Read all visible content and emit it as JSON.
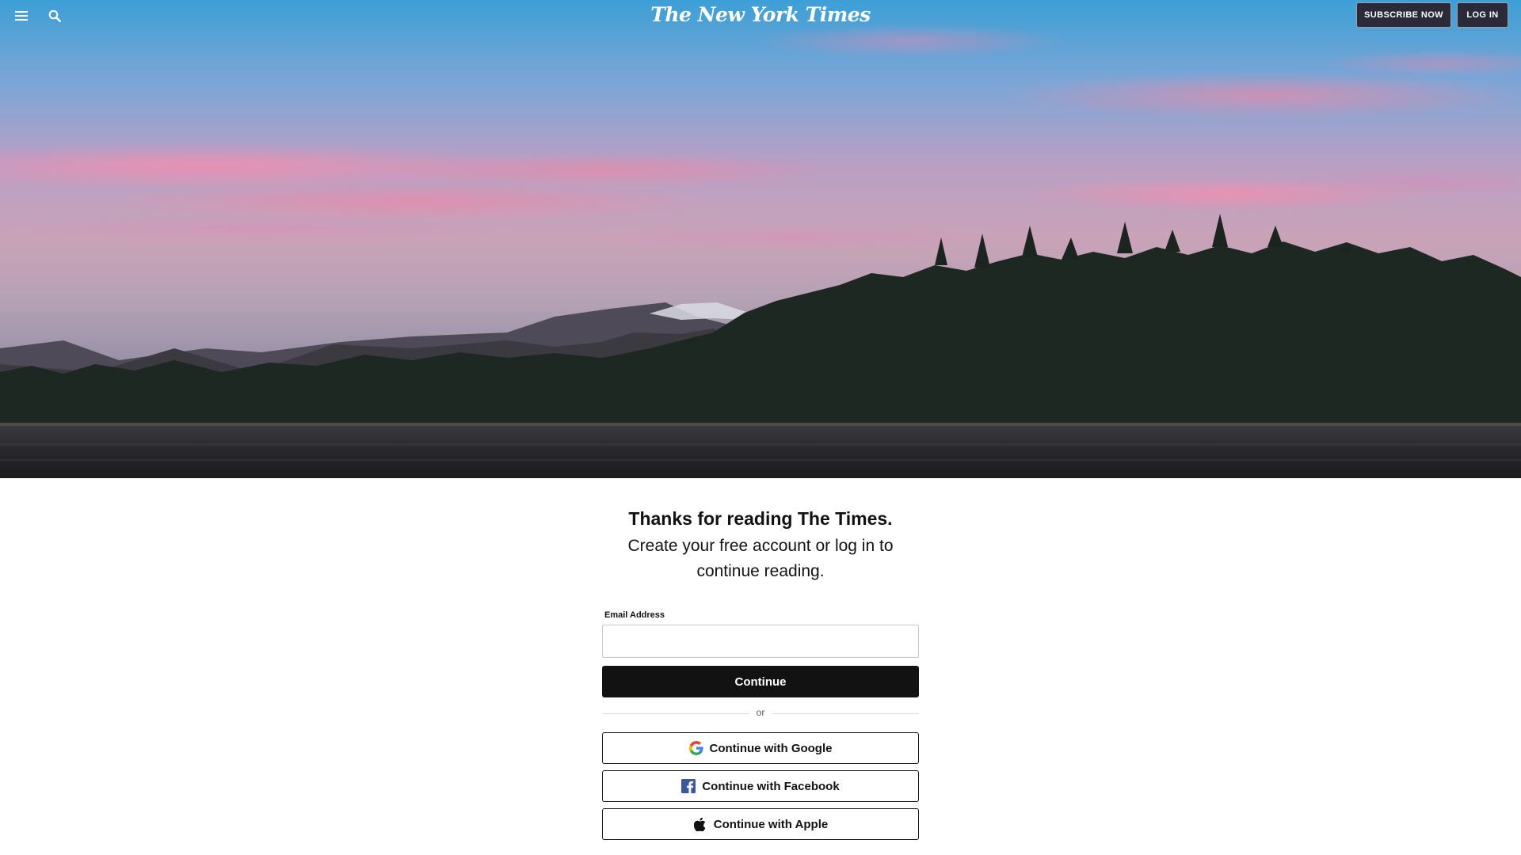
{
  "header": {
    "logo_text": "The New York Times",
    "subscribe_label": "SUBSCRIBE NOW",
    "login_label": "LOG IN",
    "menu_icon": "hamburger-icon",
    "search_icon": "search-icon"
  },
  "gate": {
    "headline": "Thanks for reading The Times.",
    "subhead": "Create your free account or log in to continue reading.",
    "email_label": "Email Address",
    "email_value": "",
    "continue_label": "Continue",
    "divider_text": "or",
    "google_label": "Continue with Google",
    "facebook_label": "Continue with Facebook",
    "apple_label": "Continue with Apple"
  },
  "colors": {
    "brand_black": "#121212",
    "header_button_bg": "#2a2a3a",
    "sky_top": "#3aa0d8",
    "sky_pink": "#e59ab0",
    "forest": "#1f2a22"
  }
}
